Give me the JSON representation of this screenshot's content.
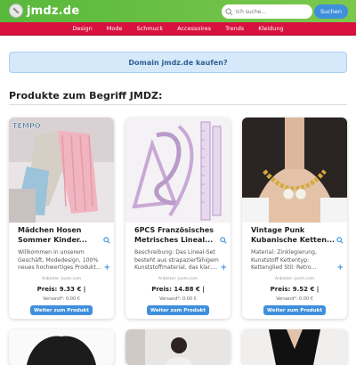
{
  "header": {
    "logo_text": "jmdz.de",
    "search_placeholder": "Ich suche...",
    "search_button": "Suchen"
  },
  "nav": {
    "items": [
      "Design",
      "Mode",
      "Schmuck",
      "Accessoires",
      "Trends",
      "Kleidung"
    ]
  },
  "banner": {
    "text": "Domain jmdz.de kaufen?"
  },
  "section_title": "Produkte zum Begriff JMDZ:",
  "products": [
    {
      "title": "Mädchen Hosen Sommer Kinder...",
      "description": "Willkommen in unserem Geschäft, Modedesign, 100% neues hochwertiges Produkt...",
      "vendor": "Anbieter: joom.com",
      "price": "Preis: 9.33 € |",
      "shipping": "Versand*: 0.00 €",
      "button": "Weiter zum Produkt",
      "image_text": "TEMPO"
    },
    {
      "title": "6PCS Französisches Metrisches Lineal...",
      "description": "Beschreibung: Das Lineal-Set besteht aus strapazierfähigem Kunststoffmaterial, das klar,...",
      "vendor": "Anbieter: joom.com",
      "price": "Preis: 14.88 € |",
      "shipping": "Versand*: 0.00 €",
      "button": "Weiter zum Produkt"
    },
    {
      "title": "Vintage Punk Kubanische Ketten...",
      "description": "Material: Zinklegierung, Kunststoff Kettentyp: Kettenglied Stil: Retro...",
      "vendor": "Anbieter: joom.com",
      "price": "Preis: 9.52 € |",
      "shipping": "Versand*: 0.00 €",
      "button": "Weiter zum Produkt"
    }
  ],
  "colors": {
    "header_green": "#58b83b",
    "nav_red": "#d8113f",
    "accent_blue": "#3f8fdc",
    "banner_bg": "#d5e9fb"
  }
}
